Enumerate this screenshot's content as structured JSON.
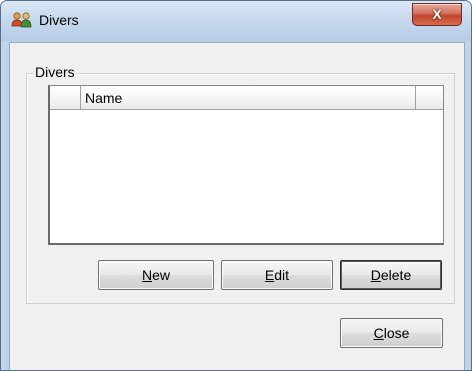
{
  "window": {
    "title": "Divers",
    "close_glyph": "X",
    "icon": "people-icon"
  },
  "group": {
    "label": "Divers"
  },
  "list": {
    "columns": [
      "",
      "Name",
      ""
    ],
    "rows": []
  },
  "buttons": {
    "new": {
      "mnemonic": "N",
      "rest": "ew"
    },
    "edit": {
      "mnemonic": "E",
      "rest": "dit"
    },
    "delete": {
      "mnemonic": "D",
      "rest": "elete"
    },
    "close": {
      "mnemonic": "C",
      "rest": "lose"
    }
  },
  "colors": {
    "titlebar": "#c6d9ee",
    "client": "#f0f0f0",
    "close_button": "#c2452e"
  }
}
